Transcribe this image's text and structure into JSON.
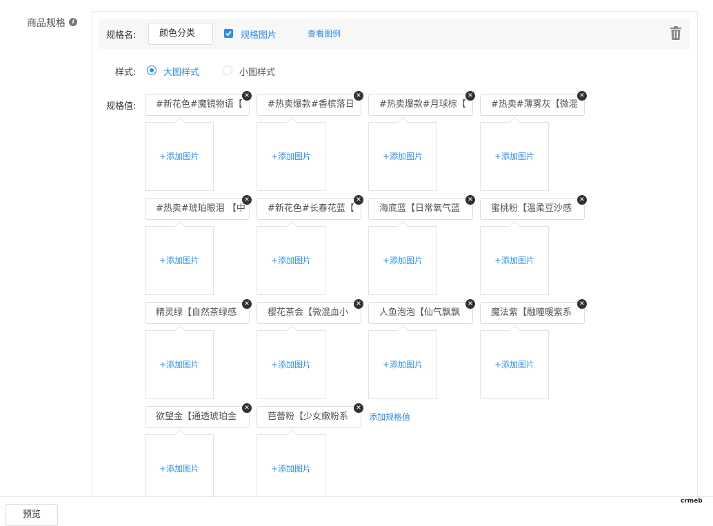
{
  "section_label": "商品规格",
  "spec": {
    "name_label": "规格名:",
    "name_value": "颜色分类",
    "image_checkbox_label": "规格图片",
    "example_link": "查看图例",
    "style_label": "样式:",
    "style_large": "大图样式",
    "style_small": "小图样式",
    "values_label": "规格值:",
    "add_image_text": "+添加图片",
    "add_value_link": "添加规格值",
    "values": [
      "#新花色#魔镜物语【",
      "#热卖爆款#香槟落日",
      "#热卖爆款#月球棕【",
      "#热卖#薄雾灰【微混",
      "#热卖#琥珀眼泪 【中",
      "#新花色#长春花蓝【",
      "海底蓝【日常氧气蓝",
      "蜜桃粉【温柔豆沙感",
      "精灵绿【自然茶绿感",
      "樱花茶会【微混血小",
      "人鱼泡泡【仙气飘飘",
      "魔法紫【融瞳暖紫系",
      "欲望金【通透琥珀金",
      "芭蕾粉【少女嫩粉系"
    ]
  },
  "footer": {
    "preview_button": "预览",
    "brand": "crmeb"
  },
  "colors": {
    "accent": "#2d8cf0"
  }
}
